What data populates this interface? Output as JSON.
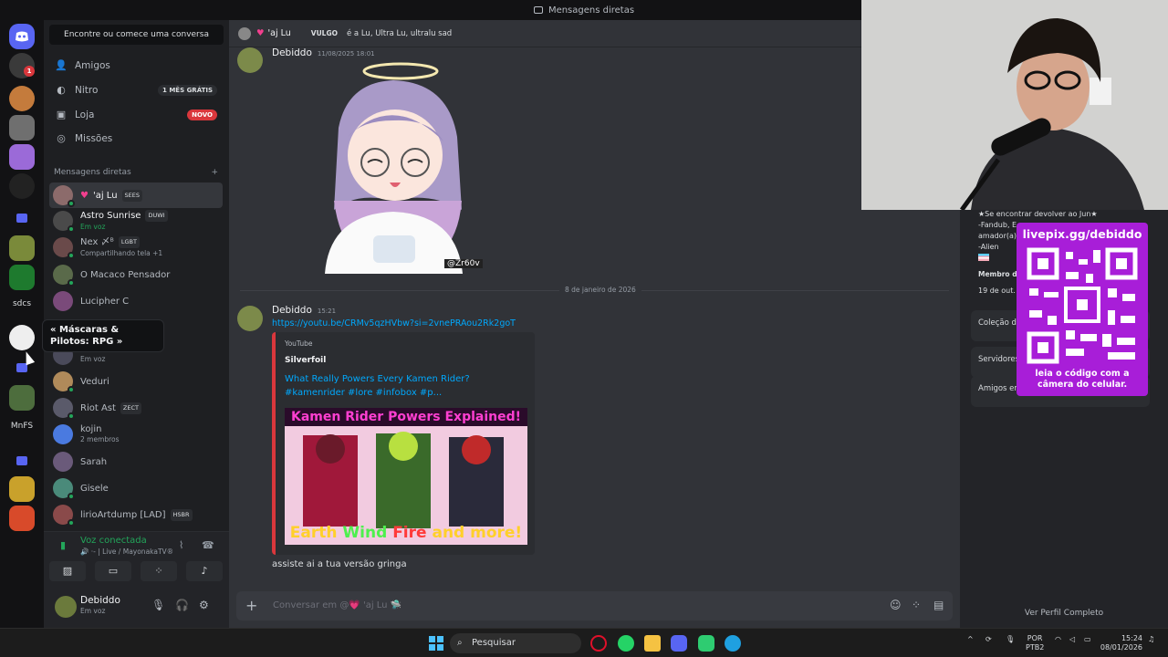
{
  "window": {
    "title": "Mensagens diretas"
  },
  "rail": {
    "labels": [
      "sdcs",
      "MnFS"
    ],
    "badge": "1",
    "tooltip": "« Máscaras & Pilotos: RPG »"
  },
  "sidebar": {
    "search_placeholder": "Encontre ou comece uma conversa",
    "nav": [
      {
        "label": "Amigos",
        "icon": "friends-icon"
      },
      {
        "label": "Nitro",
        "icon": "nitro-icon",
        "pill": "1 MÊS GRÁTIS"
      },
      {
        "label": "Loja",
        "icon": "shop-icon",
        "pill": "NOVO"
      },
      {
        "label": "Missões",
        "icon": "quests-icon"
      }
    ],
    "dm_header": "Mensagens diretas",
    "dms": [
      {
        "name": "'aj Lu",
        "tag": "SEES",
        "sub": ""
      },
      {
        "name": "Astro Sunrise",
        "tag": "DUWI",
        "sub": "Em voz"
      },
      {
        "name": "Nex 〆ᴮ",
        "tag": "LGBT",
        "sub": "Compartilhando tela +1"
      },
      {
        "name": "O Macaco Pensador",
        "tag": "",
        "sub": ""
      },
      {
        "name": "Lucipher C",
        "tag": "",
        "sub": ""
      },
      {
        "name": "",
        "tag": "",
        "sub": "Em voz"
      },
      {
        "name": "Veduri",
        "tag": "",
        "sub": ""
      },
      {
        "name": "Riot Ast",
        "tag": "ZECT",
        "sub": ""
      },
      {
        "name": "kojin",
        "tag": "",
        "sub": "2 membros"
      },
      {
        "name": "Sarah",
        "tag": "",
        "sub": ""
      },
      {
        "name": "Gisele",
        "tag": "",
        "sub": ""
      },
      {
        "name": "lirioArtdump [LAD]",
        "tag": "HSBR",
        "sub": ""
      }
    ],
    "voice": {
      "status": "Voz conectada",
      "channel": "🔊 ·- | Live / MayonakaTV®"
    },
    "user": {
      "name": "Debiddo",
      "status": "Em voz"
    }
  },
  "main": {
    "header": {
      "name": "'aj Lu",
      "vulgo": "VULGO",
      "desc": "é a Lu, Ultra Lu, ultralu sad"
    },
    "msg1": {
      "author": "Debiddo",
      "time": "11/08/2025 18:01",
      "sticker_credit": "@Zr60v"
    },
    "divider": "8 de janeiro de 2026",
    "msg2": {
      "author": "Debiddo",
      "time": "15:21",
      "link": "https://youtu.be/CRMv5qzHVbw?si=2vnePRAou2Rk2goT",
      "embed": {
        "provider": "YouTube",
        "channel": "Silverfoil",
        "title": "What Really Powers Every Kamen Rider? #kamenrider #lore #infobox #p...",
        "thumb_top": "Kamen Rider Powers Explained!",
        "thumb_bottom": [
          "Earth",
          "Wind",
          "Fire",
          "and more!"
        ]
      },
      "text": "assiste ai a tua versão gringa"
    },
    "composer_placeholder": "Conversar em @💗 'aj Lu 🛸"
  },
  "profile": {
    "bio": [
      "★Se encontrar devolver ao Jun★",
      "-Fandub, E...",
      "amador(a)",
      "-Alien"
    ],
    "member_since_label": "Membro de",
    "member_since": "19 de out.",
    "cards": [
      "Coleção d",
      "Servidores",
      "Amigos em"
    ],
    "qr_title": "livepix.gg/debiddo",
    "qr_caption": "leia o código com a câmera do celular.",
    "view_full": "Ver Perfil Completo"
  },
  "taskbar": {
    "search": "Pesquisar",
    "lang": "POR",
    "layout": "PTB2",
    "time": "15:24",
    "date": "08/01/2026"
  },
  "colors": {
    "accent": "#5865f2",
    "online": "#23a55a",
    "link": "#00a8fc",
    "qr_bg": "#a81ed8"
  }
}
